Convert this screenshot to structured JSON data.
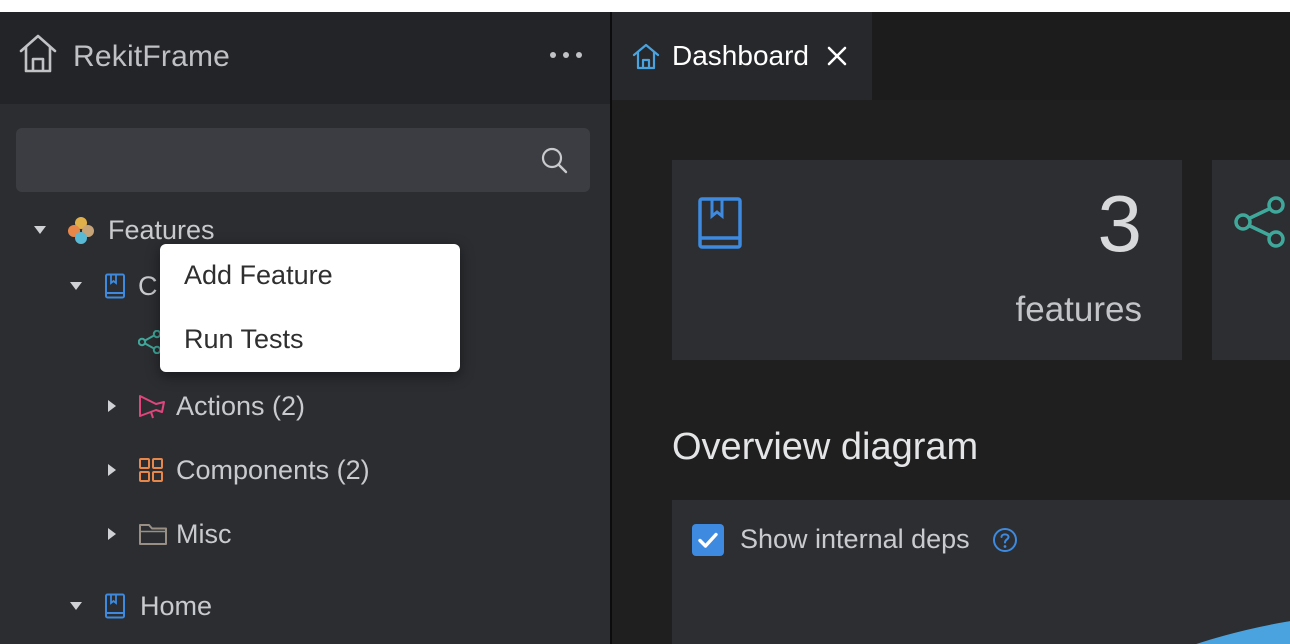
{
  "sidebar": {
    "title": "RekitFrame",
    "tree": {
      "features_label": "Features",
      "common_label_fragment": "C",
      "actions_label": "Actions (2)",
      "components_label": "Components (2)",
      "misc_label": "Misc",
      "home_label": "Home"
    }
  },
  "context_menu": {
    "items": [
      "Add Feature",
      "Run Tests"
    ]
  },
  "tabs": [
    {
      "label": "Dashboard",
      "icon": "home-icon",
      "active": true
    }
  ],
  "dashboard": {
    "stat_card": {
      "count": "3",
      "unit": "features",
      "icon": "book-icon"
    },
    "second_card_icon": "share-icon",
    "section_title": "Overview diagram",
    "show_internal_deps_label": "Show internal deps",
    "show_internal_deps_checked": true
  },
  "colors": {
    "accent_blue": "#3d8ae0",
    "action_pink": "#e0457b",
    "component_orange": "#e8874a",
    "share_teal": "#3fa89b"
  }
}
